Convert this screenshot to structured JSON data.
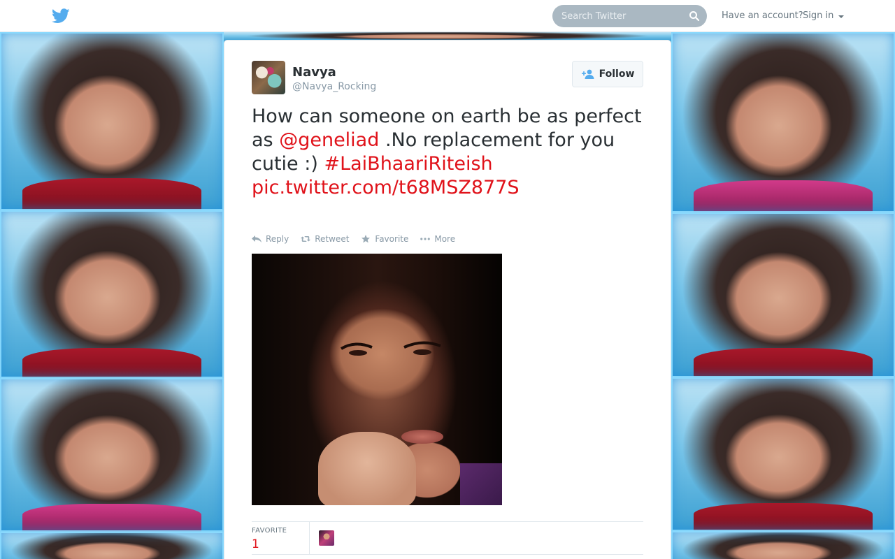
{
  "topbar": {
    "search_placeholder": "Search Twitter",
    "have_account": "Have an account?",
    "sign_in": "Sign in"
  },
  "tweet": {
    "author_name": "Navya",
    "author_handle": "@Navya_Rocking",
    "follow_label": "Follow",
    "text_part1": "How can someone on earth be as perfect as ",
    "mention": "@geneliad",
    "text_part2": " .No replacement for you cutie :) ",
    "hashtag": "#LaiBhaariRiteish",
    "link": "pic.twitter.com/t68MSZ877S",
    "actions": {
      "reply": "Reply",
      "retweet": "Retweet",
      "favorite": "Favorite",
      "more": "More"
    },
    "stats": {
      "favorite_label": "FAVORITE",
      "favorite_count": "1"
    }
  },
  "colors": {
    "link": "#e0121a",
    "twitter_blue": "#55acee",
    "background": "#4aa8d6"
  },
  "icons": {
    "logo": "twitter-bird-icon",
    "search": "search-icon",
    "follow": "add-user-icon",
    "reply": "reply-icon",
    "retweet": "retweet-icon",
    "favorite": "star-icon",
    "more": "ellipsis-icon"
  }
}
